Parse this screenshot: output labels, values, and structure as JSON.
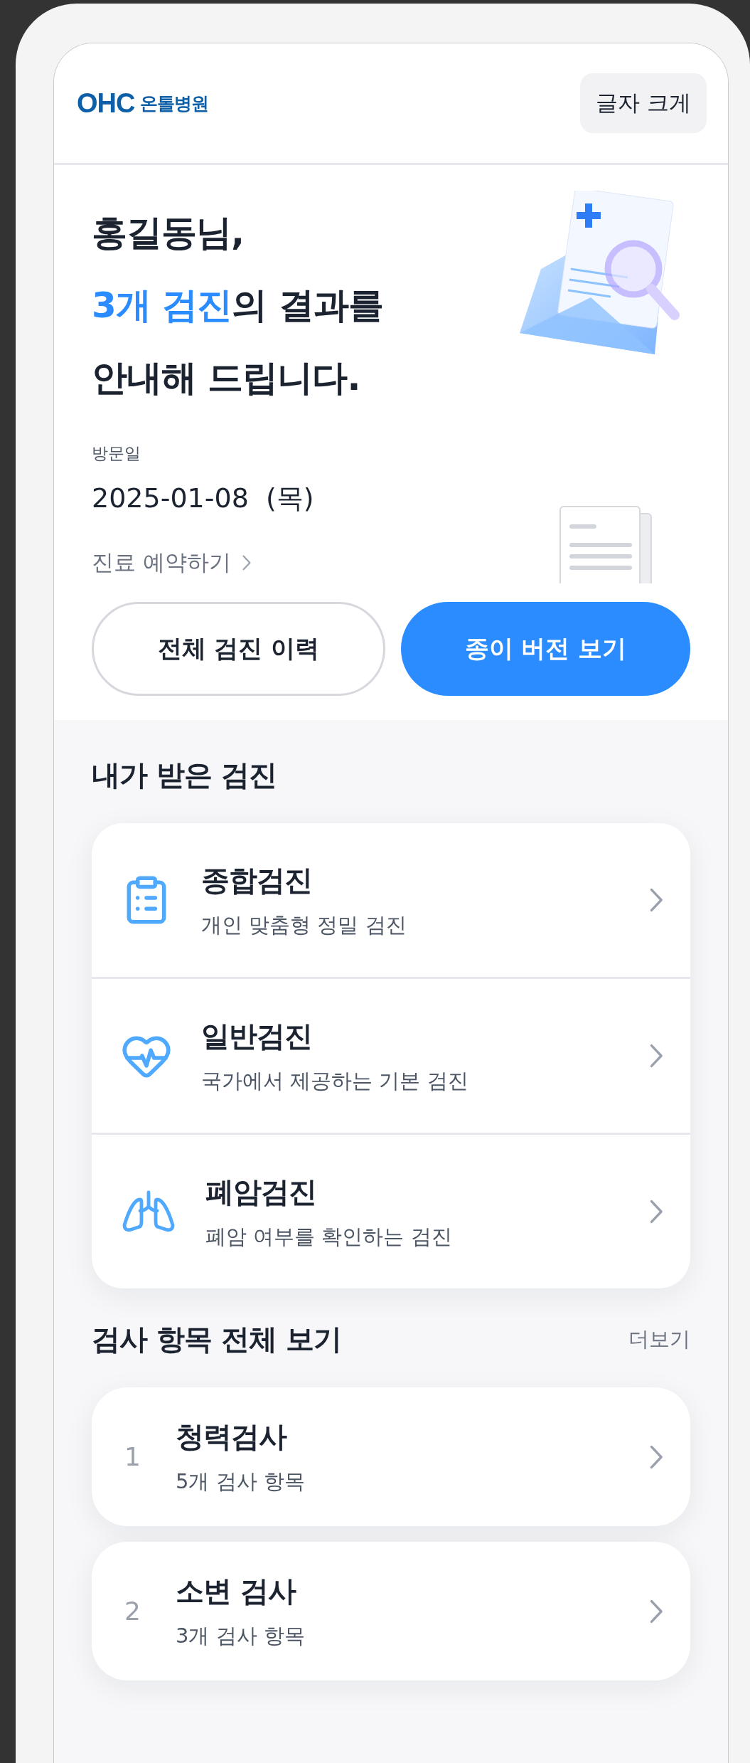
{
  "header": {
    "logo_mark": "OHC",
    "logo_name": "온톨병원",
    "font_size_button": "글자 크게"
  },
  "hero": {
    "greeting": "홍길동님,",
    "headline_highlight": "3개 검진",
    "headline_rest": "의 결과를",
    "headline_last": "안내해 드립니다.",
    "visit_label": "방문일",
    "visit_date": "2025-01-08  (목)",
    "reservation_link": "진료 예약하기",
    "buttons": [
      {
        "label": "전체 검진 이력",
        "kind": "outline"
      },
      {
        "label": "종이 버전 보기",
        "kind": "primary"
      }
    ]
  },
  "my_checkups": {
    "title": "내가 받은 검진",
    "items": [
      {
        "title": "종합검진",
        "subtitle": "개인 맞춤형 정밀 검진"
      },
      {
        "title": "일반검진",
        "subtitle": "국가에서 제공하는 기본 검진"
      },
      {
        "title": "폐암검진",
        "subtitle": "폐암 여부를 확인하는 검진"
      }
    ]
  },
  "test_items": {
    "title": "검사 항목 전체 보기",
    "more": "더보기",
    "items": [
      {
        "number": "1",
        "name": "청력검사",
        "count": "5개 검사 항목"
      },
      {
        "number": "2",
        "name": "소변 검사",
        "count": "3개 검사 항목"
      }
    ]
  }
}
